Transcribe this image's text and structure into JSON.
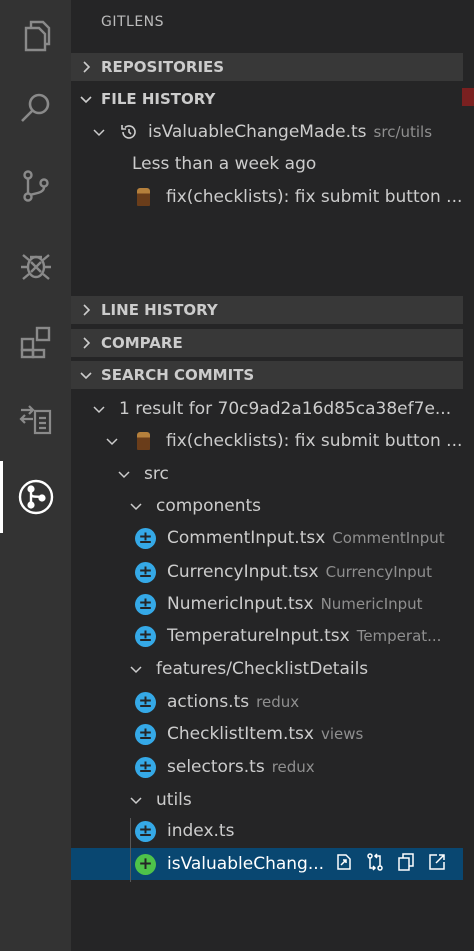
{
  "panel": {
    "title": "GITLENS"
  },
  "activity_bar": [
    {
      "icon": "files-icon"
    },
    {
      "icon": "search-icon"
    },
    {
      "icon": "source-control-icon"
    },
    {
      "icon": "debug-icon"
    },
    {
      "icon": "extensions-icon"
    },
    {
      "icon": "remote-explorer-icon"
    },
    {
      "icon": "gitlens-icon",
      "active": true
    }
  ],
  "sections": {
    "repositories": "REPOSITORIES",
    "file_history": "FILE HISTORY",
    "line_history": "LINE HISTORY",
    "compare": "COMPARE",
    "search_commits": "SEARCH COMMITS"
  },
  "file_history": {
    "file": "isValuableChangeMade.ts",
    "path": "src/utils",
    "group": "Less than a week ago",
    "commit": "fix(checklists): fix submit button ..."
  },
  "search": {
    "result": "1 result for 70c9ad2a16d85ca38ef7e...",
    "commit": "fix(checklists): fix submit button ...",
    "folders": {
      "src": "src",
      "components": "components",
      "checklist_details": "features/ChecklistDetails",
      "utils": "utils"
    },
    "files": [
      {
        "name": "CommentInput.tsx",
        "desc": "CommentInput",
        "status": "±"
      },
      {
        "name": "CurrencyInput.tsx",
        "desc": "CurrencyInput",
        "status": "±"
      },
      {
        "name": "NumericInput.tsx",
        "desc": "NumericInput",
        "status": "±"
      },
      {
        "name": "TemperatureInput.tsx",
        "desc": "Temperat...",
        "status": "±"
      },
      {
        "name": "actions.ts",
        "desc": "redux",
        "status": "±"
      },
      {
        "name": "ChecklistItem.tsx",
        "desc": "views",
        "status": "±"
      },
      {
        "name": "selectors.ts",
        "desc": "redux",
        "status": "±"
      },
      {
        "name": "index.ts",
        "desc": "",
        "status": "±"
      },
      {
        "name": "isValuableChang...",
        "desc": "",
        "status": "+"
      }
    ]
  },
  "colors": {
    "modified": "#35a9e7",
    "added": "#4ec24a",
    "selection": "#094771"
  }
}
